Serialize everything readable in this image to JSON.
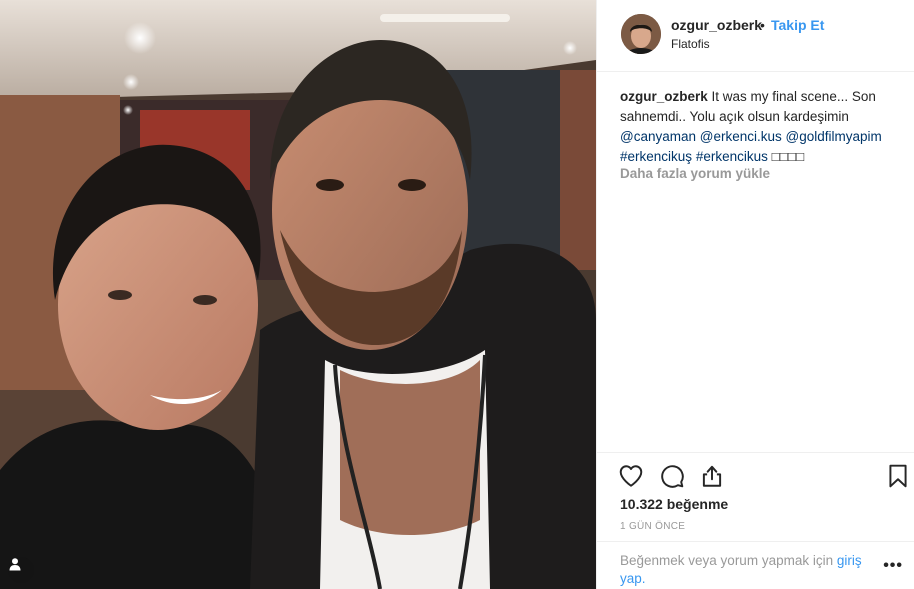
{
  "post": {
    "username": "ozgur_ozberk",
    "dot": "•",
    "follow_label": "Takip Et",
    "location": "Flatofis",
    "caption": {
      "username": "ozgur_ozberk",
      "text_1": "It was my final scene... Son sahnemdi.. Yolu açık olsun kardeşimin",
      "mentions": [
        "@canyaman",
        "@erkenci.kus",
        "@goldfilmyapim"
      ],
      "hashtags": [
        "#erkencikuş",
        "#erkencikus"
      ],
      "emoji_placeholder": "□□□□"
    },
    "load_more_label": "Daha fazla yorum yükle",
    "likes": "10.322 beğenme",
    "time": "1 GÜN ÖNCE",
    "footer": {
      "text": "Beğenmek veya yorum yapmak için",
      "login_label": "giriş yap."
    },
    "more_label": "•••"
  },
  "icons": {
    "like": "heart-icon",
    "comment": "comment-icon",
    "share": "share-icon",
    "save": "bookmark-icon",
    "user_tags": "user-icon"
  },
  "colors": {
    "link_blue": "#3897f0",
    "mention_blue": "#003569",
    "text_primary": "#262626",
    "text_secondary": "#999999",
    "divider": "#efefef"
  }
}
